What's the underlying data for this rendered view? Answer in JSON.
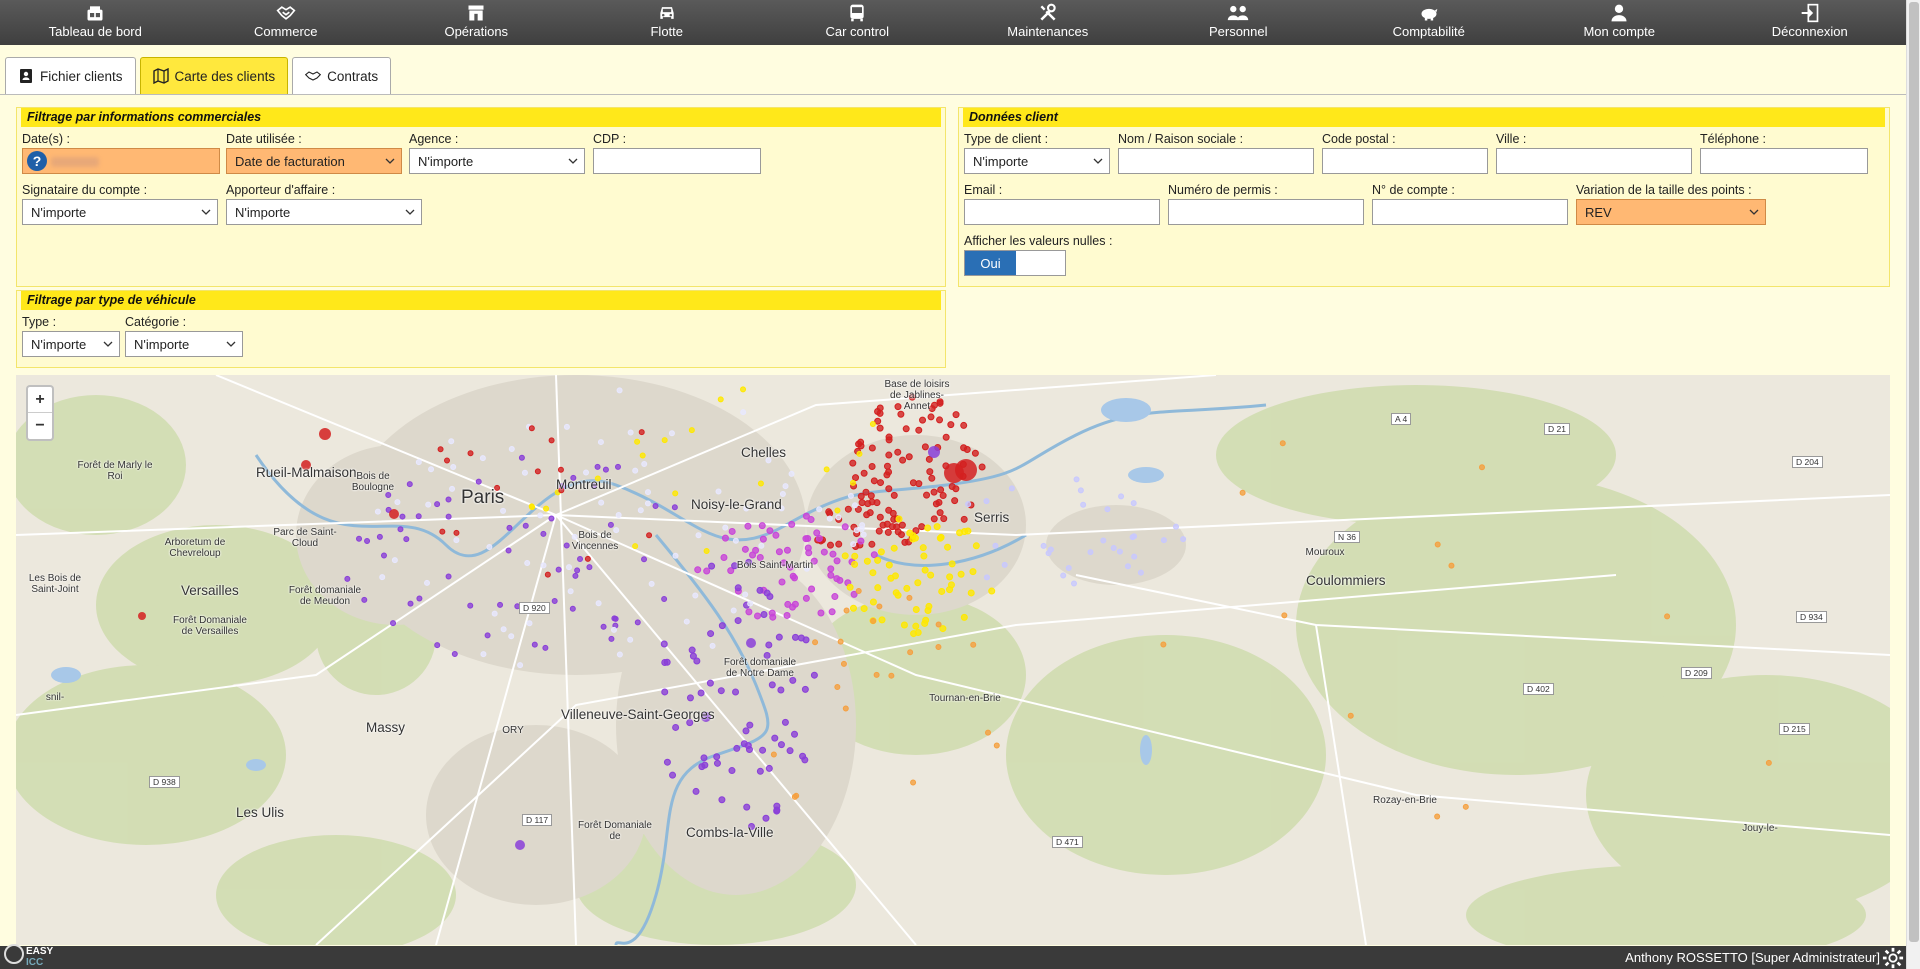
{
  "nav": [
    {
      "label": "Tableau de bord",
      "icon": "dashboard-icon"
    },
    {
      "label": "Commerce",
      "icon": "handshake-icon"
    },
    {
      "label": "Opérations",
      "icon": "store-icon"
    },
    {
      "label": "Flotte",
      "icon": "car-icon"
    },
    {
      "label": "Car control",
      "icon": "bus-icon"
    },
    {
      "label": "Maintenances",
      "icon": "tools-icon"
    },
    {
      "label": "Personnel",
      "icon": "users-icon"
    },
    {
      "label": "Comptabilité",
      "icon": "piggy-bank-icon"
    },
    {
      "label": "Mon compte",
      "icon": "user-icon"
    },
    {
      "label": "Déconnexion",
      "icon": "logout-icon"
    }
  ],
  "tabs": [
    {
      "label": "Fichier clients",
      "icon": "address-book-icon",
      "active": false
    },
    {
      "label": "Carte des clients",
      "icon": "map-icon",
      "active": true
    },
    {
      "label": "Contrats",
      "icon": "handshake-icon",
      "active": false
    }
  ],
  "commercial_filter": {
    "title": "Filtrage par informations commerciales",
    "dates_label": "Date(s) :",
    "date_used_label": "Date utilisée :",
    "date_used_value": "Date de facturation",
    "agency_label": "Agence :",
    "agency_value": "N'importe",
    "cdp_label": "CDP :",
    "cdp_value": "",
    "signatory_label": "Signataire du compte :",
    "signatory_value": "N'importe",
    "provider_label": "Apporteur d'affaire :",
    "provider_value": "N'importe"
  },
  "client_data": {
    "title": "Données client",
    "client_type_label": "Type de client :",
    "client_type_value": "N'importe",
    "name_label": "Nom / Raison sociale :",
    "postal_label": "Code postal :",
    "city_label": "Ville :",
    "phone_label": "Téléphone :",
    "email_label": "Email :",
    "permit_label": "Numéro de permis :",
    "account_label": "N° de compte :",
    "point_size_label": "Variation de la taille des points :",
    "point_size_value": "REV",
    "show_null_label": "Afficher les valeurs nulles :",
    "show_null_value": "Oui"
  },
  "vehicle_filter": {
    "title": "Filtrage par type de véhicule",
    "type_label": "Type :",
    "type_value": "N'importe",
    "category_label": "Catégorie :",
    "category_value": "N'importe"
  },
  "map": {
    "zoom_in": "+",
    "zoom_out": "−",
    "places": [
      {
        "name": "Paris",
        "size": "big"
      },
      {
        "name": "Rueil-Malmaison",
        "size": "mid"
      },
      {
        "name": "Montreuil",
        "size": "mid"
      },
      {
        "name": "Noisy-le-Grand",
        "size": "mid"
      },
      {
        "name": "Chelles",
        "size": "mid"
      },
      {
        "name": "Serris",
        "size": "mid"
      },
      {
        "name": "Versailles",
        "size": "mid"
      },
      {
        "name": "Coulommiers",
        "size": "mid"
      },
      {
        "name": "Massy",
        "size": "mid"
      },
      {
        "name": "Villeneuve-Saint-Georges",
        "size": "mid"
      },
      {
        "name": "Les Ulis",
        "size": "mid"
      },
      {
        "name": "Combs-la-Ville",
        "size": "mid"
      },
      {
        "name": "Bois de Boulogne",
        "size": "small"
      },
      {
        "name": "Bois de Vincennes",
        "size": "small"
      },
      {
        "name": "Bois Saint-Martin",
        "size": "small"
      },
      {
        "name": "Forêt de Marly le Roi",
        "size": "small"
      },
      {
        "name": "Parc de Saint-Cloud",
        "size": "small"
      },
      {
        "name": "Arboretum de Chevreloup",
        "size": "small"
      },
      {
        "name": "Les Bois de Saint-Joint",
        "size": "small"
      },
      {
        "name": "Forêt domaniale de Meudon",
        "size": "small"
      },
      {
        "name": "Forêt Domaniale de Versailles",
        "size": "small"
      },
      {
        "name": "Forêt domaniale de Notre Dame",
        "size": "small"
      },
      {
        "name": "Forêt Domaniale de",
        "size": "small"
      },
      {
        "name": "Base de loisirs de Jablines-Annet",
        "size": "small"
      },
      {
        "name": "Mouroux",
        "size": "small"
      },
      {
        "name": "Tournan-en-Brie",
        "size": "small"
      },
      {
        "name": "Rozay-en-Brie",
        "size": "small"
      },
      {
        "name": "Jouy-le-",
        "size": "small"
      },
      {
        "name": "ORY",
        "size": "small"
      },
      {
        "name": "snil-",
        "size": "small"
      }
    ],
    "roads": [
      "A 4",
      "D 21",
      "D 204",
      "N 36",
      "D 934",
      "D 209",
      "D 402",
      "D 215",
      "D 920",
      "D 938",
      "D 117",
      "D 471"
    ]
  },
  "footer": {
    "logo_line1": "EASY",
    "logo_line2": "ICC",
    "user": "Anthony ROSSETTO [Super Administrateur]"
  },
  "colors": {
    "nav_bg": "#484848",
    "accent_yellow": "#ffe81a",
    "active_tab": "#ffe83d",
    "orange_field": "#ffb873",
    "toggle_blue": "#2a6fb5",
    "dot_red": "#d32020",
    "dot_purple": "#8a3fd8",
    "dot_yellow": "#ffe800",
    "dot_magenta": "#c845d8",
    "dot_orange": "#f5a040"
  }
}
